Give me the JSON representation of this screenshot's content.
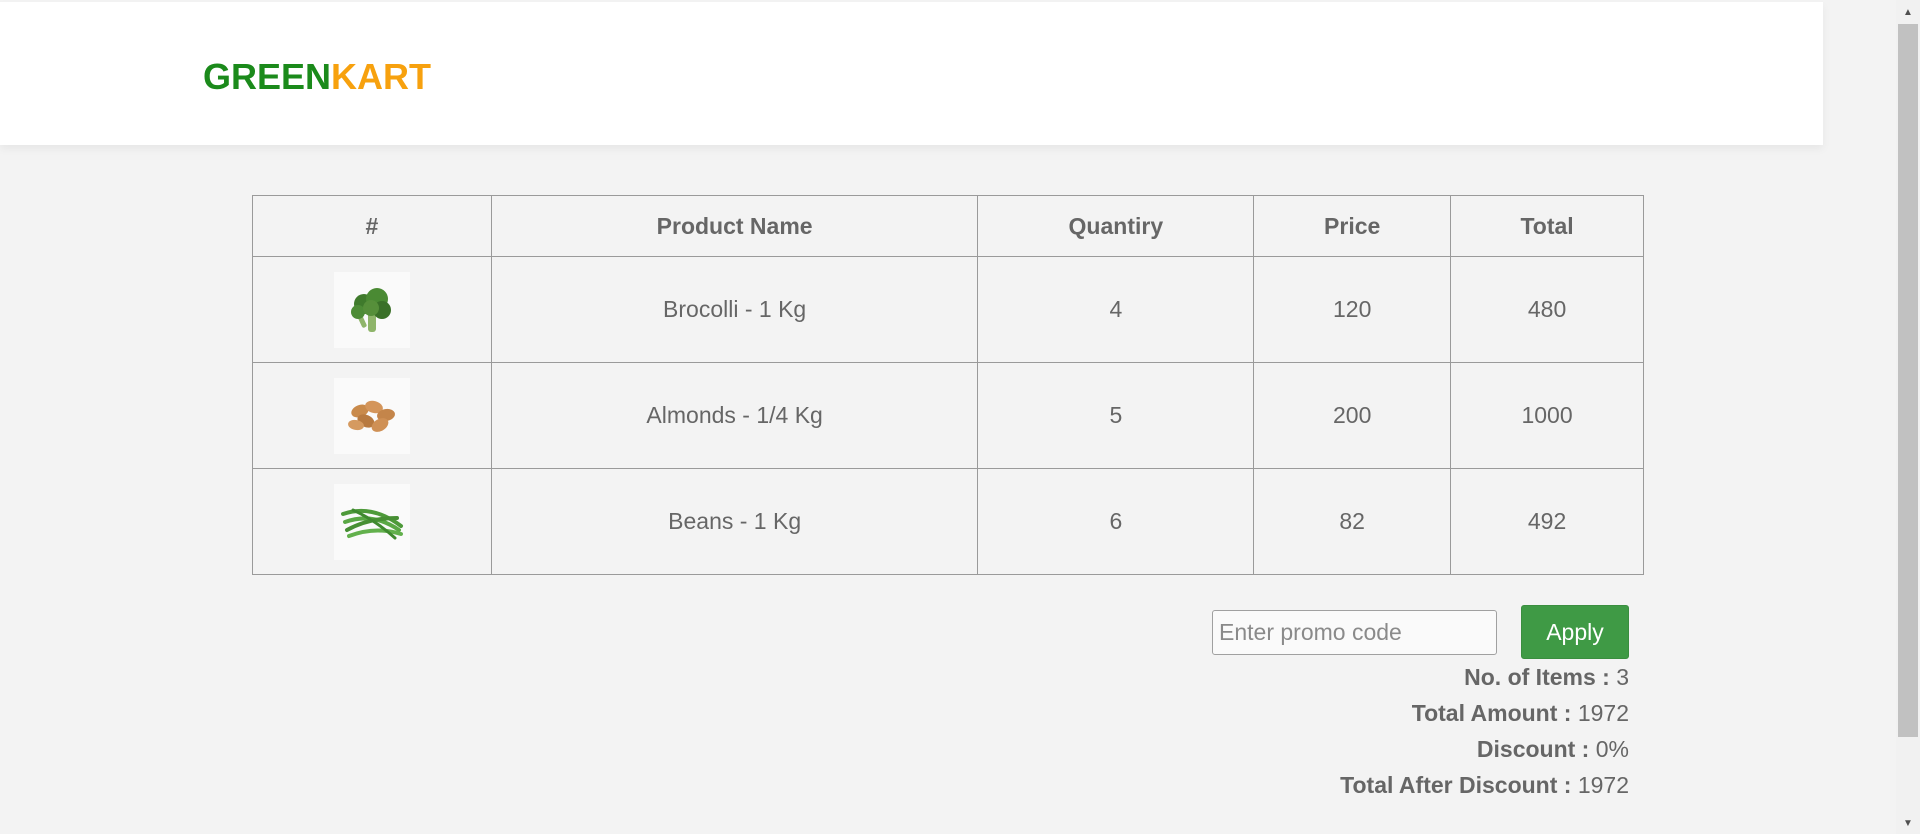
{
  "brand": {
    "part1": "GREEN",
    "part2": "KART",
    "color_green": "#1b8a1b",
    "color_orange": "#f7a10e"
  },
  "table": {
    "headers": [
      "#",
      "Product Name",
      "Quantiry",
      "Price",
      "Total"
    ],
    "rows": [
      {
        "image": "broccoli-image",
        "name": "Brocolli - 1 Kg",
        "quantity": "4",
        "price": "120",
        "total": "480"
      },
      {
        "image": "almonds-image",
        "name": "Almonds - 1/4 Kg",
        "quantity": "5",
        "price": "200",
        "total": "1000"
      },
      {
        "image": "beans-image",
        "name": "Beans - 1 Kg",
        "quantity": "6",
        "price": "82",
        "total": "492"
      }
    ]
  },
  "promo": {
    "placeholder": "Enter promo code",
    "value": "",
    "apply_label": "Apply",
    "button_color": "#3f9a45"
  },
  "summary": {
    "items_label": "No. of Items :",
    "items_value": "3",
    "amount_label": "Total Amount :",
    "amount_value": "1972",
    "discount_label": "Discount :",
    "discount_value": "0%",
    "after_label": "Total After Discount :",
    "after_value": "1972"
  }
}
